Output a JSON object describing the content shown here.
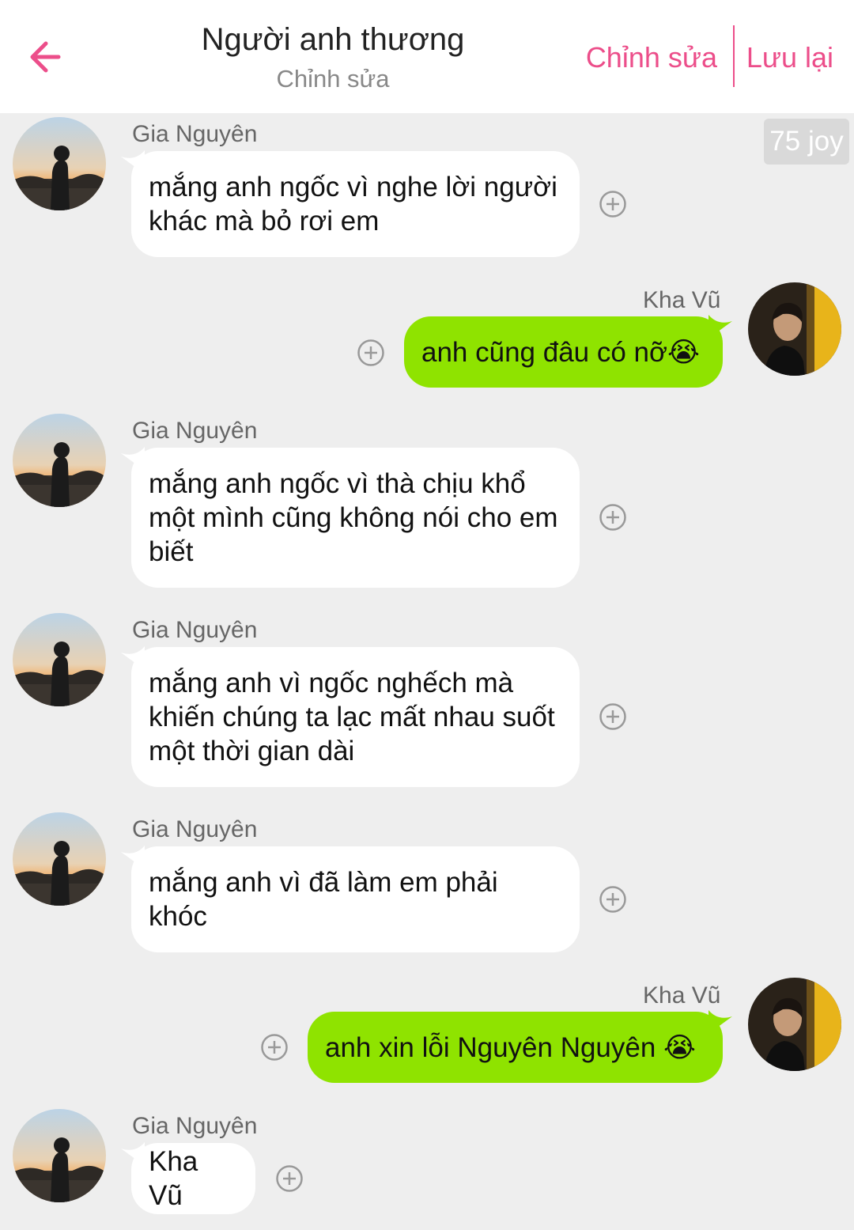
{
  "header": {
    "title": "Người anh thương",
    "subtitle": "Chỉnh sửa",
    "edit_label": "Chỉnh sửa",
    "save_label": "Lưu lại",
    "accent_color": "#ec4e8a"
  },
  "points_badge": "75 joy",
  "colors": {
    "background": "#eeeeee",
    "incoming_bubble": "#ffffff",
    "outgoing_bubble": "#8fe300"
  },
  "messages": [
    {
      "side": "left",
      "sender": "Gia Nguyên",
      "text": "mắng anh ngốc vì nghe lời người khác mà bỏ rơi em"
    },
    {
      "side": "right",
      "sender": "Kha Vũ",
      "text": "anh cũng đâu có nỡ😭"
    },
    {
      "side": "left",
      "sender": "Gia Nguyên",
      "text": "mắng anh ngốc vì thà chịu khổ một mình cũng không nói cho em biết"
    },
    {
      "side": "left",
      "sender": "Gia Nguyên",
      "text": "mắng anh vì ngốc nghếch mà khiến chúng ta lạc mất nhau suốt một thời gian dài"
    },
    {
      "side": "left",
      "sender": "Gia Nguyên",
      "text": "mắng anh vì đã làm em phải khóc"
    },
    {
      "side": "right",
      "sender": "Kha Vũ",
      "text": "anh xin lỗi Nguyên Nguyên 😭"
    },
    {
      "side": "left",
      "sender": "Gia Nguyên",
      "text": "Kha Vũ"
    }
  ]
}
